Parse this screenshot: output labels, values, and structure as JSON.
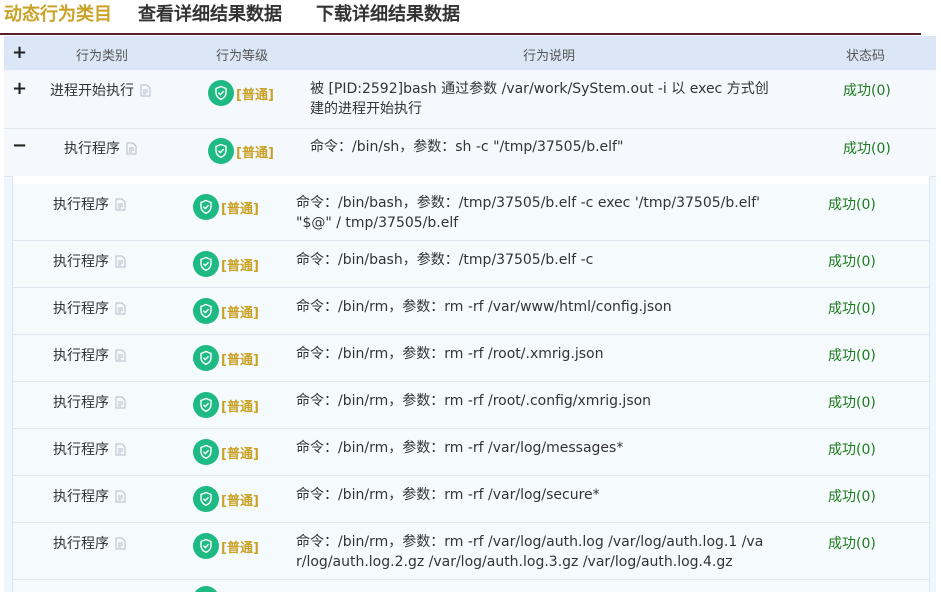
{
  "tabs": [
    {
      "label": "动态行为类目",
      "active": true
    },
    {
      "label": "查看详细结果数据",
      "active": false
    },
    {
      "label": "下载详细结果数据",
      "active": false
    }
  ],
  "table": {
    "headers": {
      "expand": "+",
      "category": "行为类别",
      "level": "行为等级",
      "description": "行为说明",
      "status": "状态码"
    },
    "rows": [
      {
        "toggle": "+",
        "category": "进程开始执行",
        "level": "[普通]",
        "description": "被 [PID:2592]bash 通过参数 /var/work/SyStem.out -i 以 exec 方式创建的进程开始执行",
        "status": "成功(0)"
      },
      {
        "toggle": "−",
        "category": "执行程序",
        "level": "[普通]",
        "description": "命令：/bin/sh，参数：sh -c \"/tmp/37505/b.elf\"",
        "status": "成功(0)"
      }
    ],
    "subrows": [
      {
        "category": "执行程序",
        "level": "[普通]",
        "description": "命令：/bin/bash，参数：/tmp/37505/b.elf -c exec '/tmp/37505/b.elf' \"$@\" / tmp/37505/b.elf",
        "status": "成功(0)"
      },
      {
        "category": "执行程序",
        "level": "[普通]",
        "description": "命令：/bin/bash，参数：/tmp/37505/b.elf -c",
        "status": "成功(0)"
      },
      {
        "category": "执行程序",
        "level": "[普通]",
        "description": "命令：/bin/rm，参数：rm -rf /var/www/html/config.json",
        "status": "成功(0)"
      },
      {
        "category": "执行程序",
        "level": "[普通]",
        "description": "命令：/bin/rm，参数：rm -rf /root/.xmrig.json",
        "status": "成功(0)"
      },
      {
        "category": "执行程序",
        "level": "[普通]",
        "description": "命令：/bin/rm，参数：rm -rf /root/.config/xmrig.json",
        "status": "成功(0)"
      },
      {
        "category": "执行程序",
        "level": "[普通]",
        "description": "命令：/bin/rm，参数：rm -rf /var/log/messages*",
        "status": "成功(0)"
      },
      {
        "category": "执行程序",
        "level": "[普通]",
        "description": "命令：/bin/rm，参数：rm -rf /var/log/secure*",
        "status": "成功(0)"
      },
      {
        "category": "执行程序",
        "level": "[普通]",
        "description": "命令：/bin/rm，参数：rm -rf /var/log/auth.log /var/log/auth.log.1 /var/log/auth.log.2.gz /var/log/auth.log.3.gz /var/log/auth.log.4.gz",
        "status": "成功(0)"
      },
      {
        "category": "",
        "level": "",
        "description": "",
        "status": ""
      }
    ]
  },
  "colors": {
    "accent": "#c9a227",
    "success": "#1e7b1e",
    "shield": "#1fba84",
    "rule": "#5a1f2c"
  },
  "icons": {
    "level": "shield-check-icon",
    "detail": "document-icon"
  }
}
